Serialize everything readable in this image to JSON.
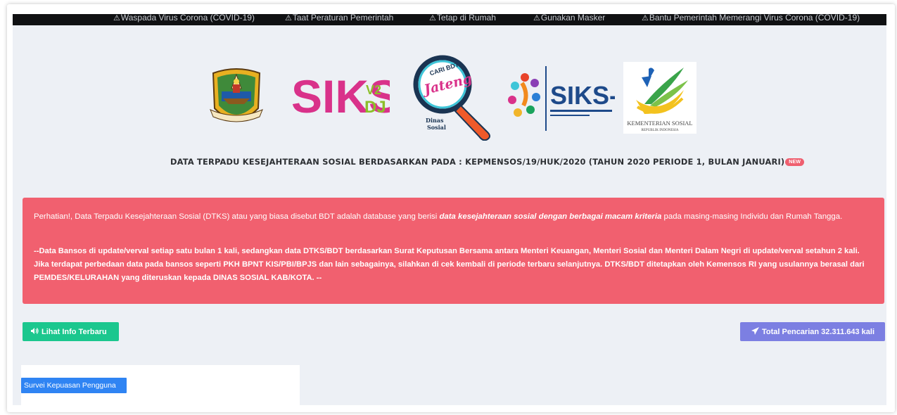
{
  "ticker": {
    "items": [
      "Waspada Virus Corona (COVID-19)",
      "Taat Peraturan Pemerintah",
      "Tetap di Rumah",
      "Gunakan Masker",
      "Bantu Pemerintah Memerangi Virus Corona (COVID-19)"
    ]
  },
  "logos": {
    "siks_dj": {
      "main": "SIKS",
      "version": "V2",
      "sub": "DJ"
    },
    "cari_bdt": {
      "line1": "CARI BDT",
      "line2": "Jateng",
      "dinas": "Dinas",
      "sosial": "Sosial"
    },
    "siks_ng": {
      "main": "SIKS-NG"
    },
    "kemensos": {
      "line1": "KEMENTERIAN SOSIAL",
      "line2": "REPUBLIK INDONESIA"
    }
  },
  "headline": {
    "text": "DATA TERPADU KESEJAHTERAAN SOSIAL BERDASARKAN PADA : KEPMENSOS/19/HUK/2020 (TAHUN 2020 PERIODE 1, BULAN JANUARI)",
    "badge": "NEW"
  },
  "alert": {
    "p1_before": "Perhatian!, Data Terpadu Kesejahteraan Sosial (DTKS) atau yang biasa disebut BDT adalah database yang berisi ",
    "p1_emphasis": "data kesejahteraan sosial dengan berbagai macam kriteria",
    "p1_after": " pada masing-masing Individu dan Rumah Tangga.",
    "p2": "--Data Bansos di update/verval setiap satu bulan 1 kali, sedangkan data DTKS/BDT berdasarkan Surat Keputusan Bersama antara Menteri Keuangan, Menteri Sosial dan Menteri Dalam Negri di update/verval setahun 2 kali. Jika terdapat perbedaan data pada bansos seperti PKH BPNT KIS/PBI/BPJS dan lain sebagainya, silahkan di cek kembali di periode terbaru selanjutnya. DTKS/BDT ditetapkan oleh Kemensos RI yang usulannya berasal dari PEMDES/KELURAHAN yang diteruskan kepada DINAS SOSIAL KAB/KOTA. --"
  },
  "buttons": {
    "info_label": "Lihat Info Terbaru",
    "total_label": "Total Pencarian 32.311.643 kali"
  },
  "survey": {
    "label": "Survei Kepuasan Pengguna"
  },
  "colors": {
    "alert": "#f1606f",
    "info_button": "#1bc78e",
    "total_button": "#7c7fe2",
    "survey_button": "#2f84f3",
    "ticker_bg": "#101113"
  },
  "icons": {
    "ticker": "warning-icon",
    "info_button": "volume-icon",
    "total_button": "paper-plane-icon"
  }
}
